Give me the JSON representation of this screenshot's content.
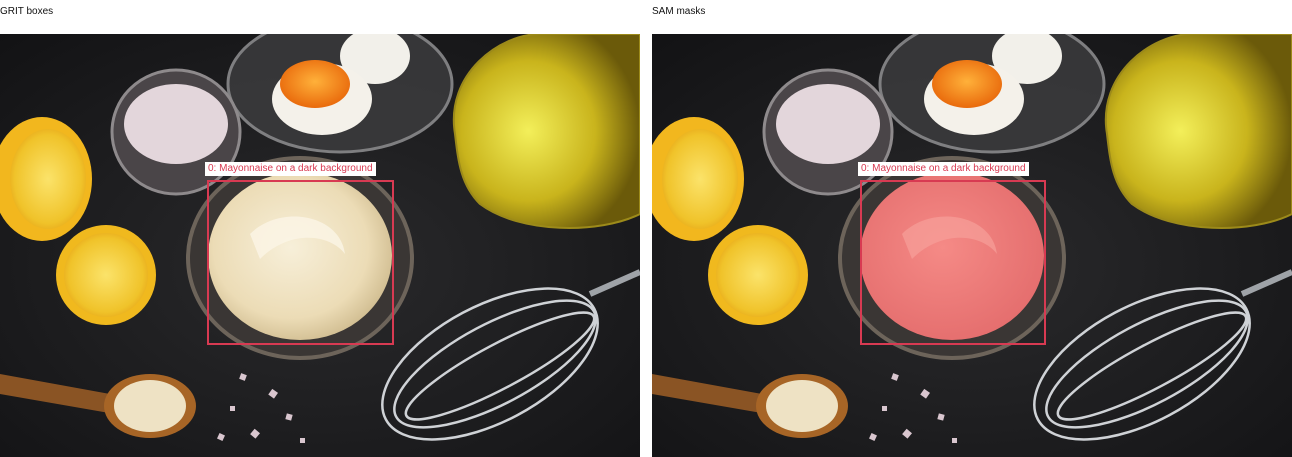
{
  "panels": {
    "left": {
      "title": "GRIT boxes"
    },
    "right": {
      "title": "SAM masks"
    }
  },
  "detection": {
    "label": "0: Mayonnaise on a dark background",
    "box_color": "#d83a52",
    "mask_color": "#f07b7b"
  },
  "scene": {
    "objects": [
      "bowl-of-mayonnaise",
      "lemon-halves",
      "salt-bowl",
      "cracked-egg-in-bowl",
      "olive-oil-jug",
      "wire-whisk",
      "wooden-spoon-with-mayonnaise",
      "salt-crystals"
    ]
  }
}
